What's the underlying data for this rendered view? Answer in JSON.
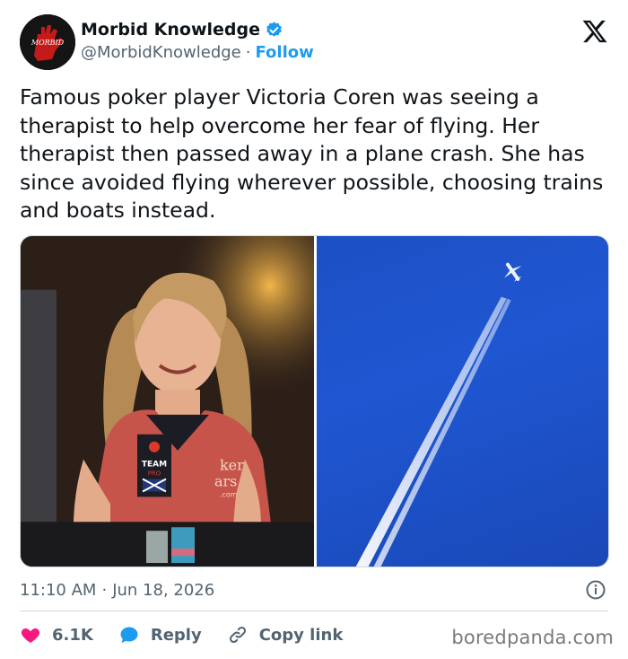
{
  "author": {
    "display_name": "Morbid Knowledge",
    "handle": "@MorbidKnowledge",
    "separator": "·",
    "follow_label": "Follow",
    "avatar_text": "MORBID"
  },
  "tweet": {
    "text": "Famous poker player Victoria Coren was seeing a therapist to help overcome her fear of flying. Her therapist then passed away in a plane crash. She has since avoided flying wherever possible, choosing trains and boats instead.",
    "time": "11:10 AM",
    "date_separator": "·",
    "date": "Jun 18, 2026"
  },
  "media": {
    "left_photo_shirt_text": [
      "TEAM",
      "PRO"
    ],
    "left_photo_bg_text": [
      "ker",
      "ars",
      ".com"
    ]
  },
  "actions": {
    "like_count": "6.1K",
    "reply_label": "Reply",
    "copy_link_label": "Copy link"
  },
  "watermark": "boredpanda.com",
  "colors": {
    "accent": "#1d9bf0",
    "like": "#f91880",
    "text": "#0f1419",
    "muted": "#536471"
  },
  "icons": {
    "verified": "verified-badge-icon",
    "brand": "x-logo-icon",
    "info": "info-icon",
    "like": "heart-icon",
    "reply": "speech-bubble-icon",
    "copy": "link-icon"
  }
}
